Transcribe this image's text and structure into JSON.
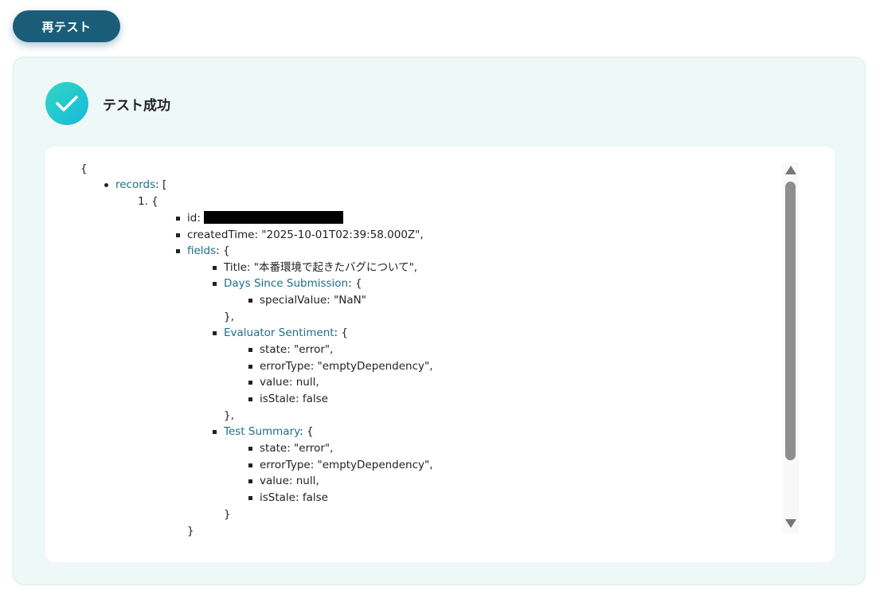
{
  "toolbar": {
    "retest_label": "再テスト"
  },
  "result": {
    "status_icon": "check-icon",
    "status_title": "テスト成功",
    "accent_color": "#1b5d78",
    "success_gradient": [
      "#34d6c2",
      "#15b9dc"
    ]
  },
  "json": {
    "open_brace": "{",
    "records_key": "records",
    "records_after": ": [",
    "item_number": "1. {",
    "id_label": "id:",
    "created_time": "createdTime: \"2025-10-01T02:39:58.000Z\",",
    "fields_key": "fields",
    "fields_after": ": {",
    "title_line": "Title: \"本番環境で起きたバグについて\",",
    "days_key": "Days Since Submission",
    "days_after": ": {",
    "special_value": "specialValue: \"NaN\"",
    "close_brace_comma_1": "},",
    "evaluator_key": "Evaluator Sentiment",
    "evaluator_after": ": {",
    "eval_state": "state: \"error\",",
    "eval_error_type": "errorType: \"emptyDependency\",",
    "eval_value": "value: null,",
    "eval_is_stale": "isStale: false",
    "close_brace_comma_2": "},",
    "summary_key": "Test Summary",
    "summary_after": ": {",
    "sum_state": "state: \"error\",",
    "sum_error_type": "errorType: \"emptyDependency\",",
    "sum_value": "value: null,",
    "sum_is_stale": "isStale: false",
    "close_brace": "}",
    "close_fields_partial": "}"
  },
  "scrollbar": {
    "up_icon": "triangle-up-icon",
    "down_icon": "triangle-down-icon"
  }
}
